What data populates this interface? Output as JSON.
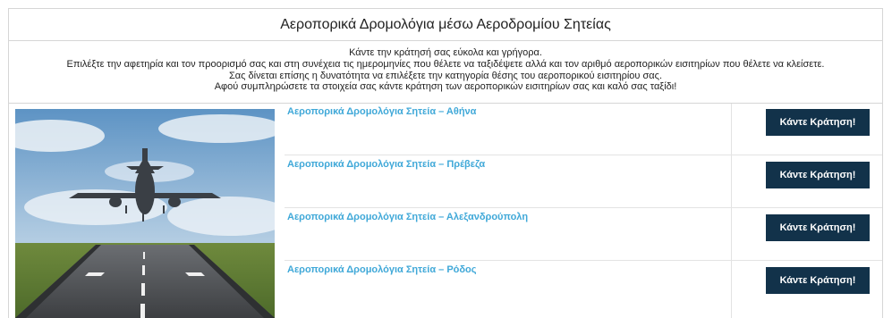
{
  "header": {
    "title": "Αεροπορικά Δρομολόγια μέσω Αεροδρομίου Σητείας"
  },
  "intro": {
    "lines": [
      "Κάντε την κράτησή σας εύκολα και γρήγορα.",
      "Επιλέξτε την αφετηρία και τον προορισμό σας και στη συνέχεια τις ημερομηνίες που θέλετε να ταξιδέψετε αλλά και τον αριθμό αεροπορικών εισιτηρίων που θέλετε να κλείσετε.",
      "Σας δίνεται επίσης η δυνατότητα να επιλέξετε την κατηγορία θέσης του αεροπορικού εισιτηρίου σας.",
      "Αφού συμπληρώσετε τα στοιχεία σας κάντε κράτηση των αεροπορικών εισιτηρίων σας και καλό σας ταξίδι!"
    ]
  },
  "routes": [
    {
      "label": "Αεροπορικά Δρομολόγια Σητεία – Αθήνα",
      "button": "Κάντε Κράτηση!"
    },
    {
      "label": "Αεροπορικά Δρομολόγια Σητεία – Πρέβεζα",
      "button": "Κάντε Κράτηση!"
    },
    {
      "label": "Αεροπορικά Δρομολόγια Σητεία – Αλεξανδρούπολη",
      "button": "Κάντε Κράτηση!"
    },
    {
      "label": "Αεροπορικά Δρομολόγια Σητεία – Ρόδος",
      "button": "Κάντε Κράτηση!"
    }
  ],
  "colors": {
    "link": "#3fa8d8",
    "button_bg": "#12324a",
    "button_text": "#ffffff",
    "border": "#d6d6d6"
  }
}
